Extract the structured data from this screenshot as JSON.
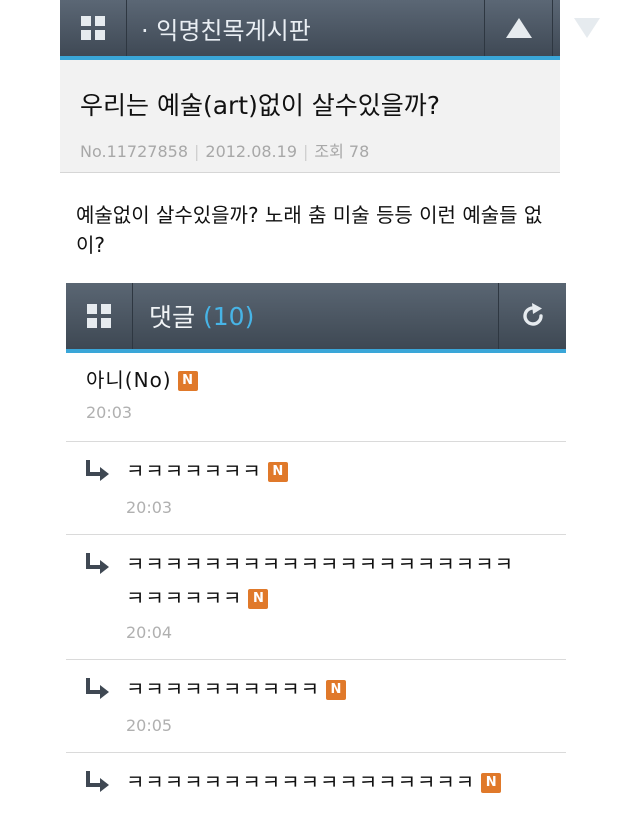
{
  "header": {
    "board_title": "· 익명친목게시판"
  },
  "post": {
    "title": "우리는 예술(art)없이 살수있을까?",
    "number": "No.11727858",
    "date": "2012.08.19",
    "views": "조회 78",
    "body": "예술없이 살수있을까? 노래 춤 미술 등등 이런 예술들 없이?"
  },
  "comments_header": {
    "label": "댓글",
    "count": "(10)"
  },
  "comments": [
    {
      "text": "아니(No)",
      "badge": "N",
      "time": "20:03",
      "reply": false
    },
    {
      "text": "ㅋㅋㅋㅋㅋㅋㅋ",
      "badge": "N",
      "time": "20:03",
      "reply": true
    },
    {
      "text_line1": "ㅋㅋㅋㅋㅋㅋㅋㅋㅋㅋㅋㅋㅋㅋㅋㅋㅋㅋㅋㅋ",
      "text_line2": "ㅋㅋㅋㅋㅋㅋ",
      "badge": "N",
      "time": "20:04",
      "reply": true
    },
    {
      "text": "ㅋㅋㅋㅋㅋㅋㅋㅋㅋㅋ",
      "badge": "N",
      "time": "20:05",
      "reply": true
    },
    {
      "text": "ㅋㅋㅋㅋㅋㅋㅋㅋㅋㅋㅋㅋㅋㅋㅋㅋㅋㅋ",
      "badge": "N",
      "reply": true
    }
  ],
  "icons": {
    "menu": "grid-icon",
    "up": "arrow-up-icon",
    "down": "arrow-down-icon",
    "refresh": "refresh-icon",
    "reply": "reply-arrow-icon",
    "new_badge": "new-badge-icon"
  },
  "colors": {
    "accent": "#3aa6d8",
    "bar": "#4b5561",
    "badge": "#e0792a"
  }
}
